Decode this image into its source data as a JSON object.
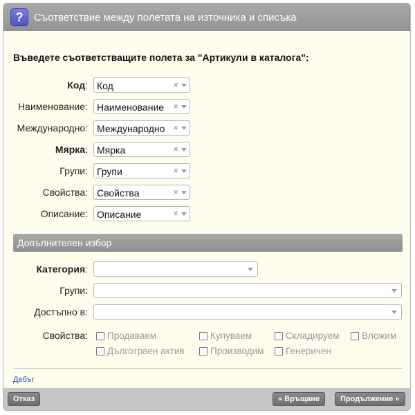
{
  "dialog": {
    "title": "Съответствие между полетата на източника и списъка",
    "help_icon_glyph": "?"
  },
  "instruction": "Въведете съответстващите полета за \"Артикули в каталога\":",
  "mapping_rows": [
    {
      "label": "Код",
      "colon": ":",
      "value": "Код",
      "bold": true
    },
    {
      "label": "Наименование",
      "colon": ":",
      "value": "Наименование",
      "bold": false
    },
    {
      "label": "Международно",
      "colon": ":",
      "value": "Международно",
      "bold": false
    },
    {
      "label": "Мярка",
      "colon": ":",
      "value": "Мярка",
      "bold": true
    },
    {
      "label": "Групи",
      "colon": ":",
      "value": "Групи",
      "bold": false
    },
    {
      "label": "Свойства",
      "colon": ":",
      "value": "Свойства",
      "bold": false
    },
    {
      "label": "Описание",
      "colon": ":",
      "value": "Описание",
      "bold": false
    }
  ],
  "clear_glyph": "×",
  "extra": {
    "section_title": "Допълнителен избор",
    "category_label": "Категория",
    "groups_label": "Групи:",
    "available_label": "Достъпно в:",
    "properties_label": "Свойства:",
    "checkboxes": [
      "Продаваем",
      "Купуваем",
      "Складируем",
      "Вложим",
      "Дълготраен актив",
      "Производим",
      "Генеричен"
    ]
  },
  "debug_link": "Дебъг",
  "buttons": {
    "cancel": "Отказ",
    "back": "« Връщане",
    "continue": "Продължение »"
  },
  "colors": {
    "background": "#fffdee",
    "titlebar": "#a0a0a0",
    "help_icon": "#5b5fd0",
    "link": "#2255aa"
  }
}
